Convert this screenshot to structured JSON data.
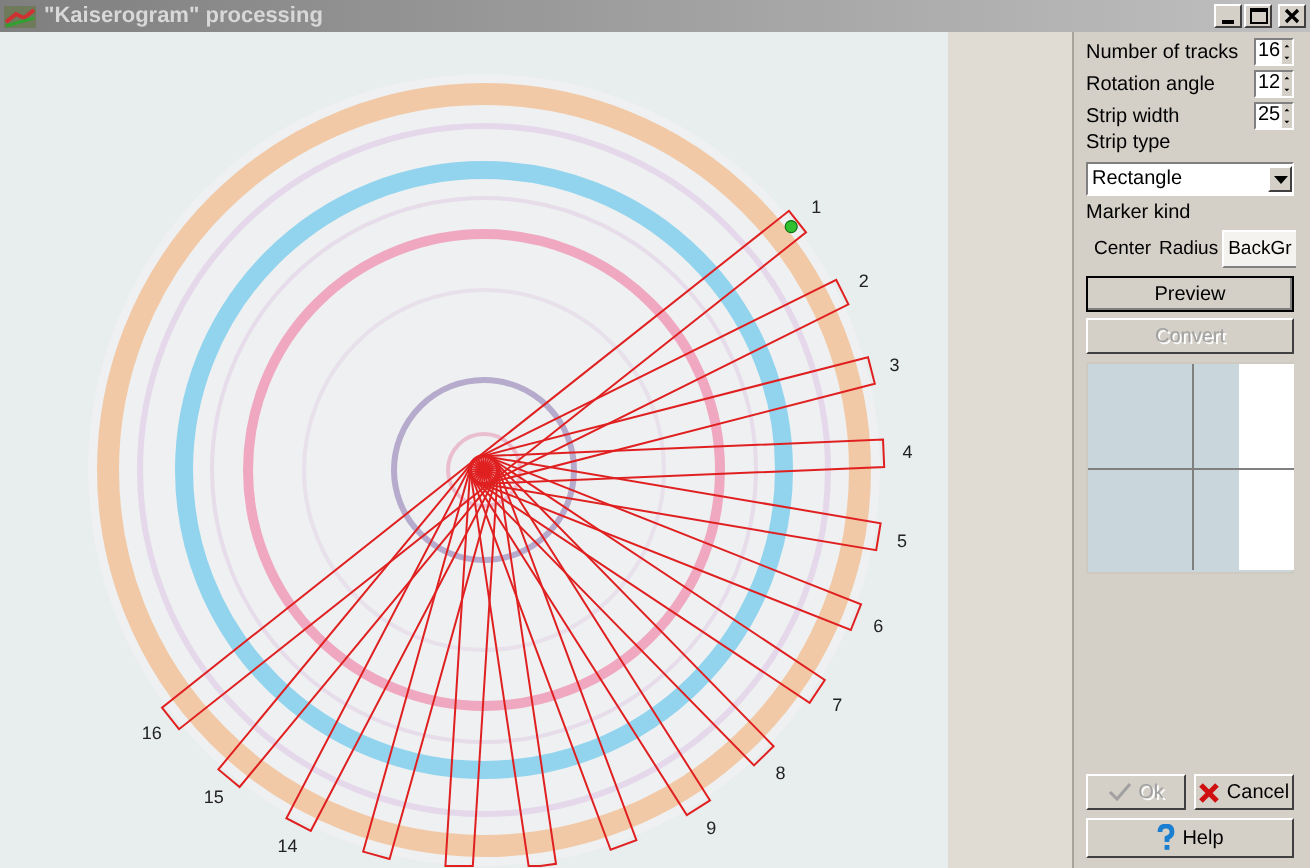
{
  "window": {
    "title": "\"Kaiserogram\" processing"
  },
  "canvas": {
    "track_labels": [
      "1",
      "2",
      "3",
      "4",
      "5",
      "6",
      "7",
      "8",
      "9",
      "14",
      "15",
      "16"
    ]
  },
  "settings": [
    {
      "label": "Number of tracks",
      "value": "16"
    },
    {
      "label": "Rotation angle",
      "value": "12"
    },
    {
      "label": "Strip width",
      "value": "25"
    }
  ],
  "strip_type": {
    "label": "Strip type",
    "value": "Rectangle"
  },
  "marker_kind": {
    "label": "Marker kind",
    "tabs": [
      {
        "label": "Center",
        "selected": false
      },
      {
        "label": "Radius",
        "selected": false
      },
      {
        "label": "BackGr",
        "selected": true
      }
    ]
  },
  "actions": [
    {
      "label": "Preview",
      "default": true,
      "disabled": false
    },
    {
      "label": "Convert",
      "default": false,
      "disabled": true
    }
  ],
  "dialog_buttons": [
    {
      "label": "Ok",
      "kind": "ok",
      "disabled": true
    },
    {
      "label": "Cancel",
      "kind": "cancel",
      "disabled": false
    },
    {
      "label": "Help",
      "kind": "help",
      "disabled": false
    }
  ]
}
